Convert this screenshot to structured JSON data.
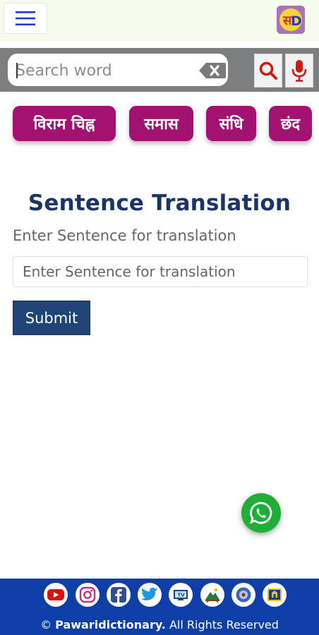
{
  "header": {
    "menu_icon": "hamburger-menu-icon",
    "logo_icon": "app-logo-icon"
  },
  "search": {
    "placeholder": "Search word",
    "clear_icon": "backspace-clear-icon",
    "search_icon": "search-icon",
    "mic_icon": "microphone-icon"
  },
  "categories": [
    {
      "label": "विराम चिह्न"
    },
    {
      "label": "समास"
    },
    {
      "label": "संधि"
    },
    {
      "label": "छंद"
    }
  ],
  "main": {
    "title": "Sentence Translation",
    "field_label": "Enter Sentence for translation",
    "field_placeholder": "Enter Sentence for translation",
    "submit_label": "Submit"
  },
  "whatsapp": {
    "icon": "whatsapp-icon"
  },
  "footer": {
    "social_icons": [
      "youtube-icon",
      "instagram-icon",
      "facebook-icon",
      "twitter-icon",
      "app-icon-1",
      "app-icon-2",
      "app-icon-3",
      "app-icon-4"
    ],
    "copyright_symbol": "©",
    "brand": "Pawaridictionary.",
    "rights": "All Rights Reserved"
  },
  "colors": {
    "chip": "#a3126f",
    "title": "#1c3566",
    "submit": "#1e4576",
    "footer": "#0e3fa8",
    "whatsapp": "#1faf38"
  }
}
